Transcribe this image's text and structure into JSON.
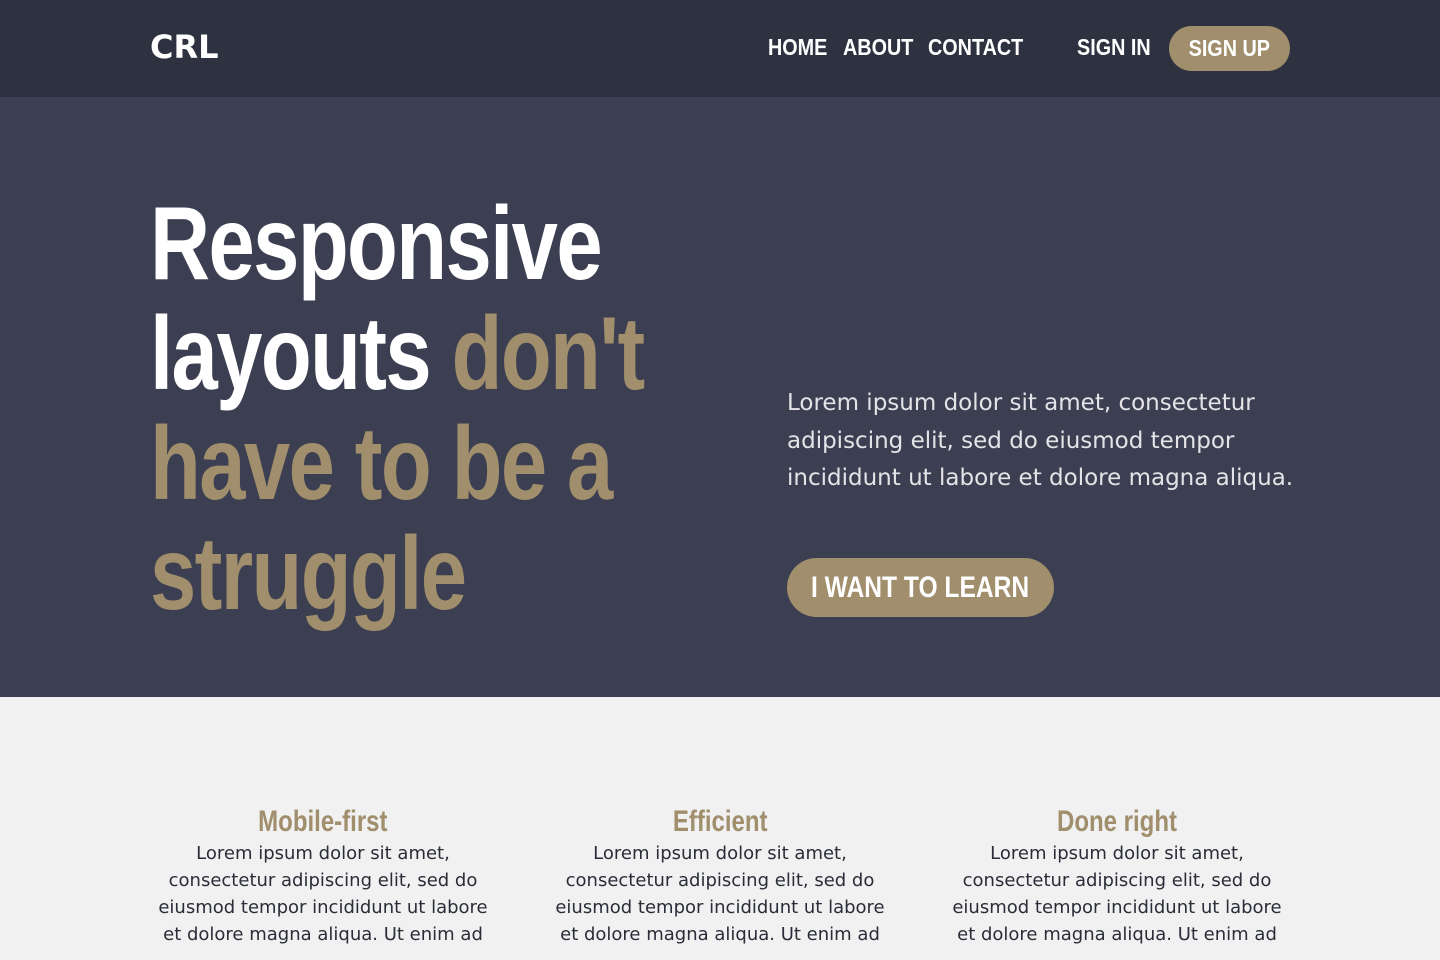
{
  "header": {
    "logo": "CRL",
    "nav": [
      "HOME",
      "ABOUT",
      "CONTACT"
    ],
    "sign_in": "SIGN IN",
    "sign_up": "SIGN UP"
  },
  "hero": {
    "title_part1_line1": "Responsive",
    "title_part1_line2_white": "layouts",
    "title_part2_line2_accent": "don't",
    "title_line3": "have to be a",
    "title_line4": "struggle",
    "text": "Lorem ipsum dolor sit amet, consectetur adipiscing elit, sed do eiusmod tempor incididunt ut labore et dolore magna aliqua.",
    "cta": "I WANT TO LEARN"
  },
  "features": [
    {
      "title": "Mobile-first",
      "text": "Lorem ipsum dolor sit amet, consectetur adipiscing elit, sed do eiusmod tempor incididunt ut labore et dolore magna aliqua. Ut enim ad"
    },
    {
      "title": "Efficient",
      "text": "Lorem ipsum dolor sit amet, consectetur adipiscing elit, sed do eiusmod tempor incididunt ut labore et dolore magna aliqua. Ut enim ad"
    },
    {
      "title": "Done right",
      "text": "Lorem ipsum dolor sit amet, consectetur adipiscing elit, sed do eiusmod tempor incididunt ut labore et dolore magna aliqua. Ut enim ad"
    }
  ],
  "colors": {
    "header_bg": "#2e3240",
    "hero_bg": "#3c3f51",
    "accent": "#a08e6c",
    "page_bg": "#f1f1f1"
  }
}
